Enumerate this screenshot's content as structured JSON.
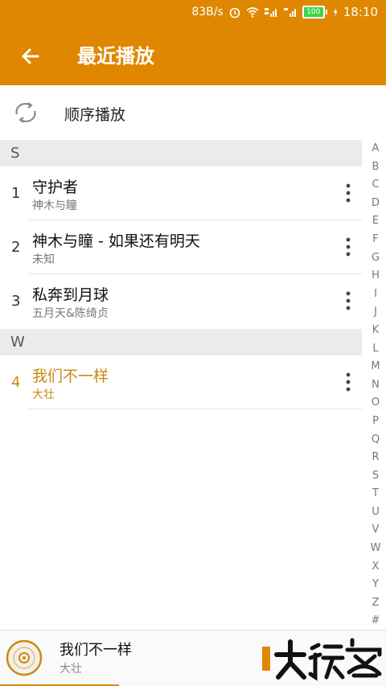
{
  "status": {
    "speed": "83B/s",
    "battery": "100",
    "time": "18:10"
  },
  "appbar": {
    "title": "最近播放"
  },
  "play_mode": {
    "label": "顺序播放"
  },
  "sections": [
    {
      "letter": "S",
      "songs": [
        {
          "index": "1",
          "title": "守护者",
          "artist": "神木与瞳"
        },
        {
          "index": "2",
          "title": "神木与瞳 - 如果还有明天",
          "artist": "未知"
        },
        {
          "index": "3",
          "title": "私奔到月球",
          "artist": "五月天&陈绮贞"
        }
      ]
    },
    {
      "letter": "W",
      "songs": [
        {
          "index": "4",
          "title": "我们不一样",
          "artist": "大壮"
        }
      ]
    }
  ],
  "alphabet": [
    "A",
    "B",
    "C",
    "D",
    "E",
    "F",
    "G",
    "H",
    "I",
    "J",
    "K",
    "L",
    "M",
    "N",
    "O",
    "P",
    "Q",
    "R",
    "S",
    "T",
    "U",
    "V",
    "W",
    "X",
    "Y",
    "Z",
    "#"
  ],
  "mini_player": {
    "title": "我们不一样",
    "artist": "大壮"
  },
  "colors": {
    "accent": "#df8700",
    "active_song": "#c98a12"
  }
}
